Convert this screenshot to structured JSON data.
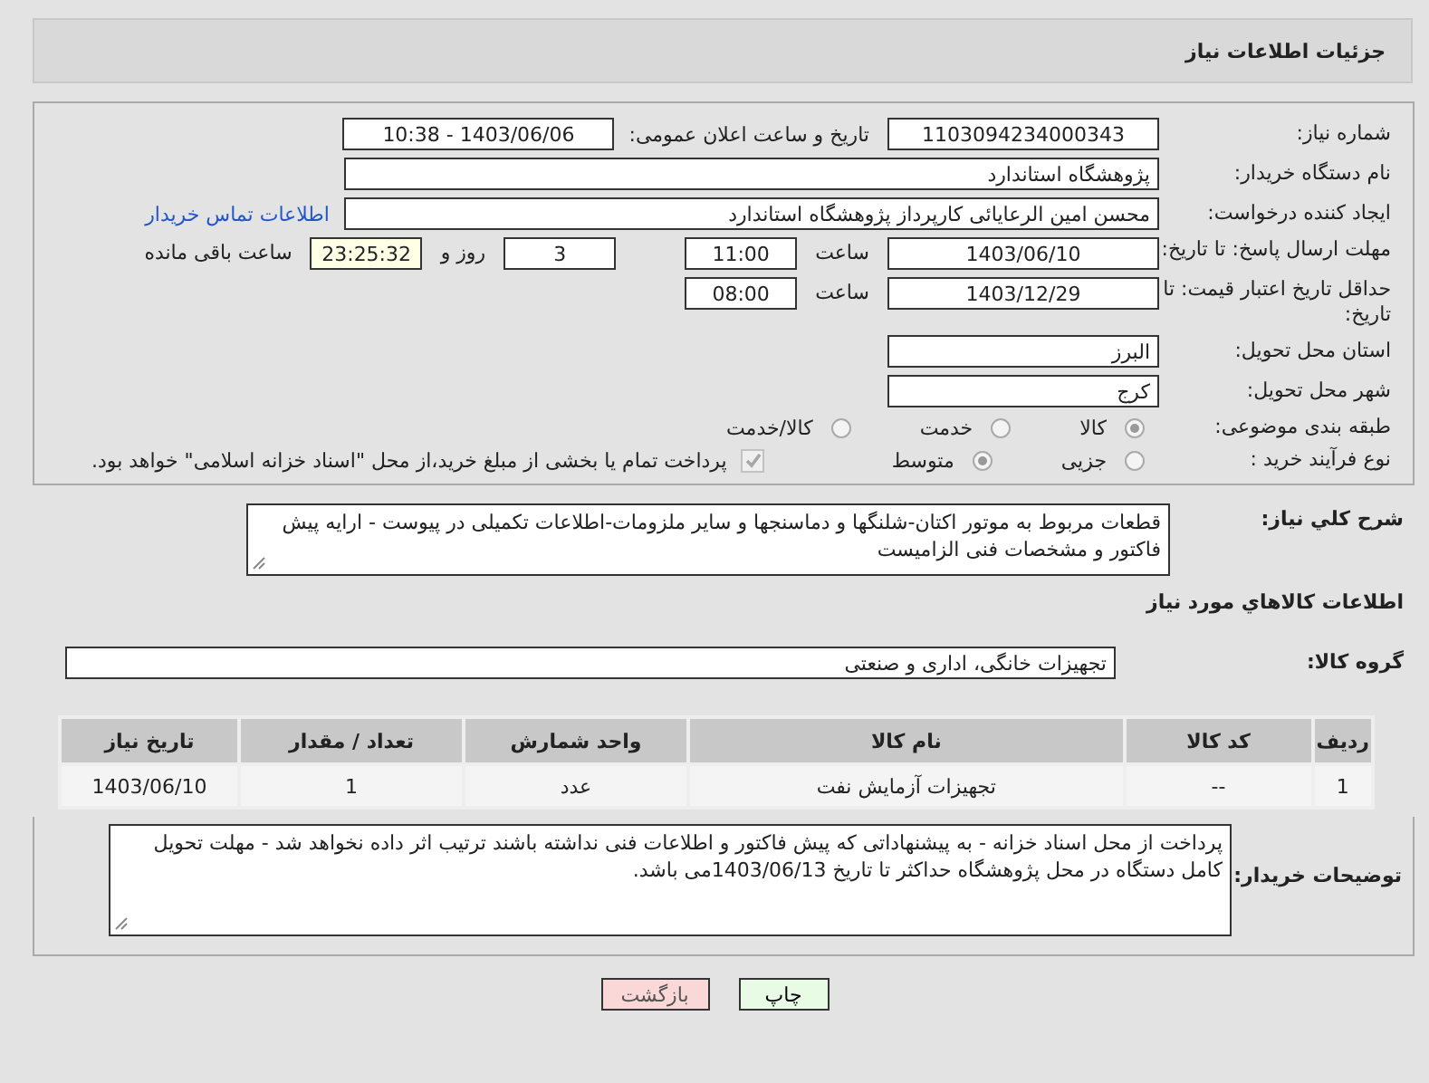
{
  "header": {
    "title": "جزئیات اطلاعات نیاز"
  },
  "need_number": {
    "label": "شماره نیاز:",
    "value": "1103094234000343"
  },
  "announce": {
    "label": "تاریخ و ساعت اعلان عمومی:",
    "value": "1403/06/06 - 10:38"
  },
  "buyer_org": {
    "label": "نام دستگاه خریدار:",
    "value": "پژوهشگاه استاندارد"
  },
  "creator": {
    "label": "ایجاد کننده درخواست:",
    "value": "محسن امین الرعایائی کارپرداز پژوهشگاه استاندارد",
    "link": "اطلاعات تماس خریدار"
  },
  "deadline": {
    "label": "مهلت ارسال پاسخ: تا تاریخ:",
    "date": "1403/06/10",
    "time_label": "ساعت",
    "time": "11:00",
    "days": "3",
    "days_label": "روز و",
    "remaining": "23:25:32",
    "remaining_label": "ساعت باقی مانده"
  },
  "validity": {
    "label": "حداقل تاریخ اعتبار قیمت: تا تاریخ:",
    "date": "1403/12/29",
    "time_label": "ساعت",
    "time": "08:00"
  },
  "province": {
    "label": "استان محل تحویل:",
    "value": "البرز"
  },
  "city": {
    "label": "شهر محل تحویل:",
    "value": "کرج"
  },
  "category": {
    "label": "طبقه بندی موضوعی:",
    "options": [
      {
        "label": "کالا",
        "selected": true
      },
      {
        "label": "خدمت",
        "selected": false
      },
      {
        "label": "کالا/خدمت",
        "selected": false
      }
    ]
  },
  "process": {
    "label": "نوع فرآیند خرید :",
    "options": [
      {
        "label": "جزیی",
        "selected": false
      },
      {
        "label": "متوسط",
        "selected": true
      }
    ],
    "treasury": {
      "checked": true,
      "disabled": true,
      "label": "پرداخت تمام یا بخشی از مبلغ خرید،از محل \"اسناد خزانه اسلامی\" خواهد بود."
    }
  },
  "description": {
    "label": "شرح کلي نياز:",
    "value": "قطعات مربوط به موتور اکتان-شلنگها و دماسنجها و سایر ملزومات-اطلاعات تکمیلی در پیوست - ارایه پیش فاکتور و مشخصات فنی الزامیست"
  },
  "goods": {
    "title": "اطلاعات کالاهاي مورد نياز",
    "group_label": "گروه کالا:",
    "group_value": "تجهیزات خانگی، اداری و صنعتی",
    "columns": [
      "ردیف",
      "کد کالا",
      "نام کالا",
      "واحد شمارش",
      "تعداد / مقدار",
      "تاریخ نیاز"
    ],
    "rows": [
      [
        "1",
        "--",
        "تجهیزات آزمایش نفت",
        "عدد",
        "1",
        "1403/06/10"
      ]
    ]
  },
  "buyer_notes": {
    "label": "توضیحات خریدار:",
    "value": "پرداخت از محل اسناد خزانه - به پیشنهاداتی که پیش فاکتور و اطلاعات فنی نداشته باشند ترتیب اثر داده نخواهد شد - مهلت تحویل کامل دستگاه در محل پژوهشگاه حداکثر تا تاریخ 1403/06/13می باشد."
  },
  "buttons": [
    {
      "kind": "print",
      "label": "چاپ"
    },
    {
      "kind": "back",
      "label": "بازگشت"
    }
  ]
}
